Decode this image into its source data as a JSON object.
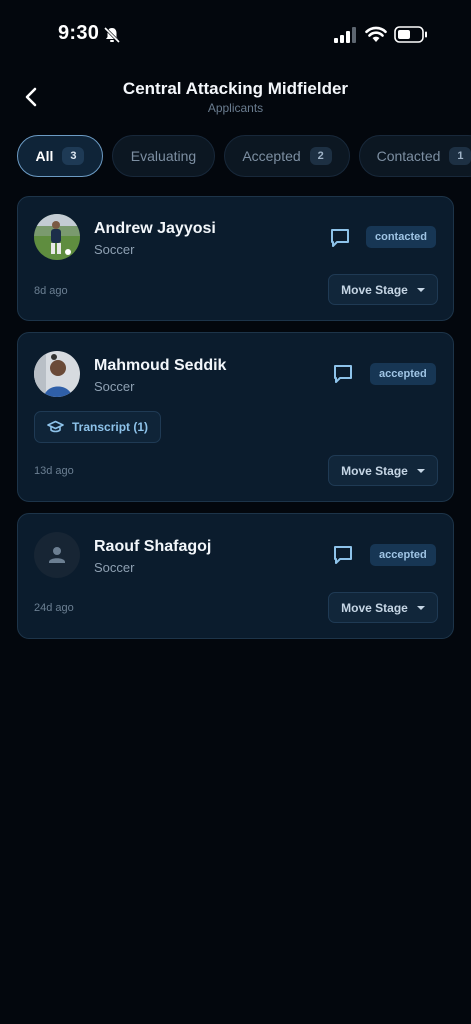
{
  "status_bar": {
    "time": "9:30"
  },
  "header": {
    "title": "Central Attacking Midfielder",
    "subtitle": "Applicants"
  },
  "tabs": [
    {
      "label": "All",
      "count": "3",
      "active": true
    },
    {
      "label": "Evaluating",
      "count": "",
      "active": false
    },
    {
      "label": "Accepted",
      "count": "2",
      "active": false
    },
    {
      "label": "Contacted",
      "count": "1",
      "active": false
    }
  ],
  "applicants": [
    {
      "name": "Andrew Jayyosi",
      "sport": "Soccer",
      "status": "contacted",
      "time_ago": "8d ago",
      "action_label": "Move Stage"
    },
    {
      "name": "Mahmoud Seddik",
      "sport": "Soccer",
      "status": "accepted",
      "time_ago": "13d ago",
      "action_label": "Move Stage",
      "attachment_label": "Transcript (1)"
    },
    {
      "name": "Raouf Shafagoj",
      "sport": "Soccer",
      "status": "accepted",
      "time_ago": "24d ago",
      "action_label": "Move Stage"
    }
  ]
}
